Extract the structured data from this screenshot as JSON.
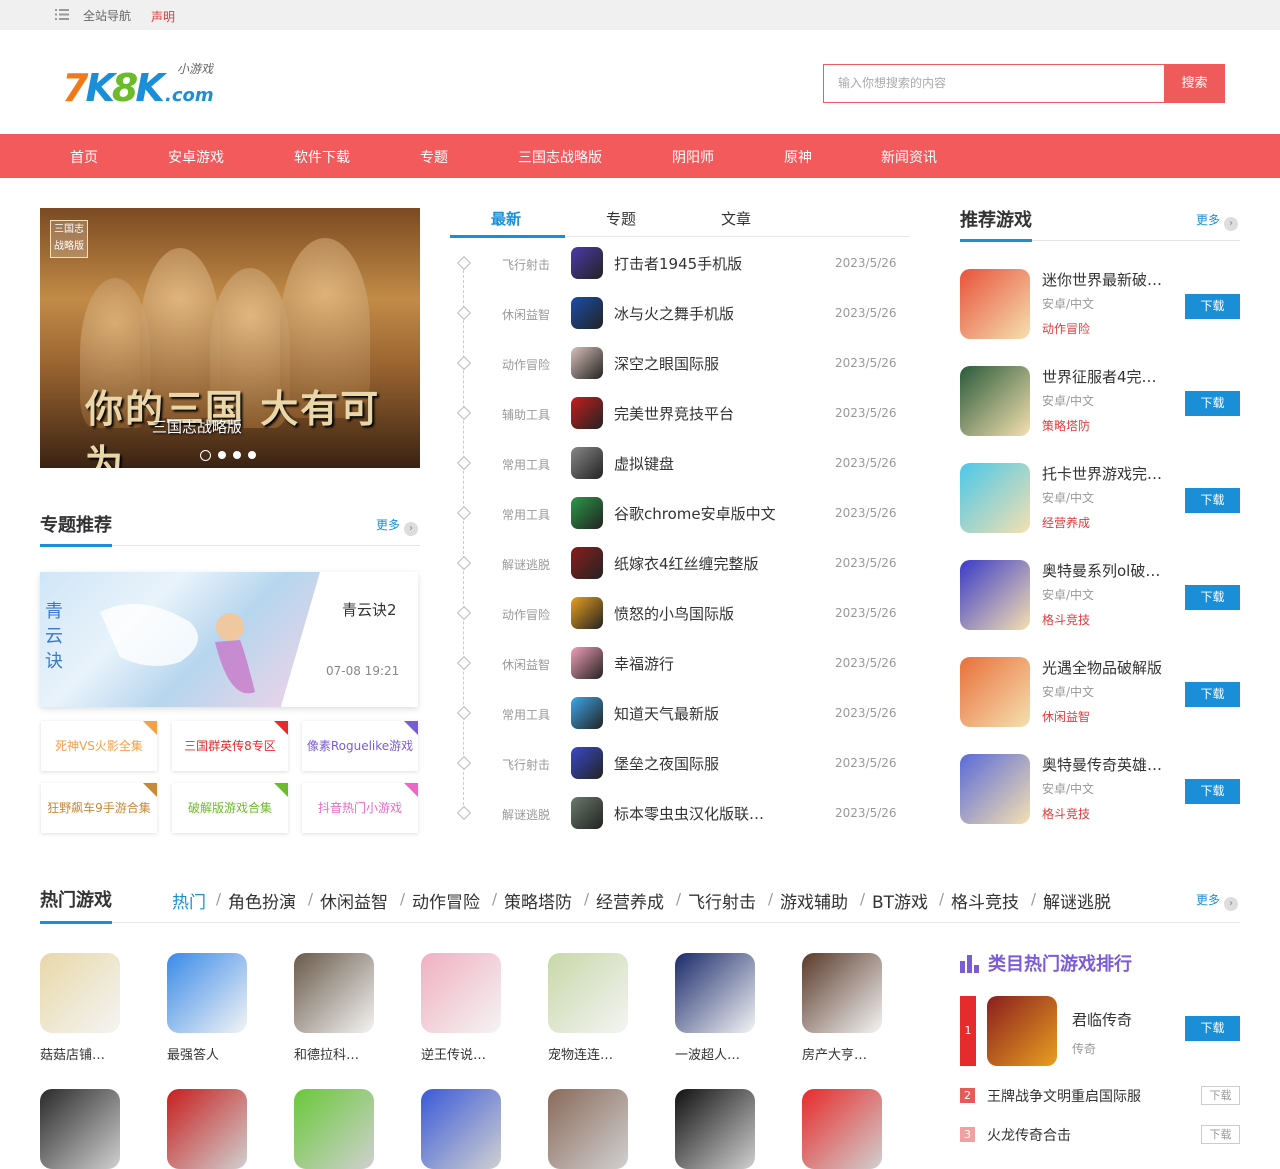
{
  "topbar": {
    "nav_label": "全站导航",
    "notice_label": "声明"
  },
  "header": {
    "logo_text": "7K8K",
    "logo_domain": ".com",
    "logo_tagline": "小游戏",
    "search_placeholder": "输入你想搜索的内容",
    "search_button": "搜索"
  },
  "nav": {
    "items": [
      "首页",
      "安卓游戏",
      "软件下载",
      "专题",
      "三国志战略版",
      "阴阳师",
      "原神",
      "新闻资讯"
    ]
  },
  "banner": {
    "stamp_text": "三国志战略版",
    "art_text": "你的三国 大有可为",
    "caption": "三国志战略版",
    "slide_count": 4,
    "active_slide": 1
  },
  "special": {
    "title": "专题推荐",
    "more": "更多",
    "card": {
      "title": "青云诀2",
      "date": "07-08 19:21"
    },
    "tags": [
      {
        "label": "死神VS火影全集",
        "color": "#f3a047"
      },
      {
        "label": "三国群英传8专区",
        "color": "#e52b2b"
      },
      {
        "label": "像素Roguelike游戏",
        "color": "#7b5cd6"
      },
      {
        "label": "狂野飙车9手游合集",
        "color": "#c8883a"
      },
      {
        "label": "破解版游戏合集",
        "color": "#6cbb2a"
      },
      {
        "label": "抖音热门小游戏",
        "color": "#e86ac6"
      }
    ]
  },
  "news": {
    "tabs": [
      "最新",
      "专题",
      "文章"
    ],
    "items": [
      {
        "cat": "飞行射击",
        "name": "打击者1945手机版",
        "date": "2023/5/26",
        "color": "#4b3aa8"
      },
      {
        "cat": "休闲益智",
        "name": "冰与火之舞手机版",
        "date": "2023/5/26",
        "color": "#1a4ea8"
      },
      {
        "cat": "动作冒险",
        "name": "深空之眼国际服",
        "date": "2023/5/26",
        "color": "#d8c0b8"
      },
      {
        "cat": "辅助工具",
        "name": "完美世界竞技平台",
        "date": "2023/5/26",
        "color": "#c41e1e"
      },
      {
        "cat": "常用工具",
        "name": "虚拟键盘",
        "date": "2023/5/26",
        "color": "#888888"
      },
      {
        "cat": "常用工具",
        "name": "谷歌chrome安卓版中文",
        "date": "2023/5/26",
        "color": "#2a9a4a"
      },
      {
        "cat": "解谜逃脱",
        "name": "纸嫁衣4红丝缠完整版",
        "date": "2023/5/26",
        "color": "#8a1e1e"
      },
      {
        "cat": "动作冒险",
        "name": "愤怒的小鸟国际版",
        "date": "2023/5/26",
        "color": "#e8a020"
      },
      {
        "cat": "休闲益智",
        "name": "幸福游行",
        "date": "2023/5/26",
        "color": "#f0a0b8"
      },
      {
        "cat": "常用工具",
        "name": "知道天气最新版",
        "date": "2023/5/26",
        "color": "#3aa8e8"
      },
      {
        "cat": "飞行射击",
        "name": "堡垒之夜国际服",
        "date": "2023/5/26",
        "color": "#3a4ac8"
      },
      {
        "cat": "解谜逃脱",
        "name": "标本零虫虫汉化版联…",
        "date": "2023/5/26",
        "color": "#6a7a6a"
      }
    ]
  },
  "recommend": {
    "title": "推荐游戏",
    "more": "更多",
    "items": [
      {
        "name": "迷你世界最新破…",
        "lang": "安卓/中文",
        "cat": "动作冒险",
        "dl": "下载",
        "color": "#e8523a"
      },
      {
        "name": "世界征服者4完…",
        "lang": "安卓/中文",
        "cat": "策略塔防",
        "dl": "下载",
        "color": "#2a5a3a"
      },
      {
        "name": "托卡世界游戏完…",
        "lang": "安卓/中文",
        "cat": "经营养成",
        "dl": "下载",
        "color": "#4ac8e8"
      },
      {
        "name": "奥特曼系列ol破…",
        "lang": "安卓/中文",
        "cat": "格斗竞技",
        "dl": "下载",
        "color": "#3a3ac8"
      },
      {
        "name": "光遇全物品破解版",
        "lang": "安卓/中文",
        "cat": "休闲益智",
        "dl": "下载",
        "color": "#e8703a"
      },
      {
        "name": "奥特曼传奇英雄…",
        "lang": "安卓/中文",
        "cat": "格斗竞技",
        "dl": "下载",
        "color": "#5a6ad8"
      }
    ]
  },
  "hot": {
    "title": "热门游戏",
    "more": "更多",
    "tabs": [
      "热门",
      "角色扮演",
      "休闲益智",
      "动作冒险",
      "策略塔防",
      "经营养成",
      "飞行射击",
      "游戏辅助",
      "BT游戏",
      "格斗竞技",
      "解谜逃脱"
    ],
    "row1": [
      {
        "name": "菇菇店铺…",
        "color": "#e8d8a8"
      },
      {
        "name": "最强答人",
        "color": "#3a8ae8"
      },
      {
        "name": "和德拉科…",
        "color": "#6a5a4a"
      },
      {
        "name": "逆王传说…",
        "color": "#f0b0c0"
      },
      {
        "name": "宠物连连…",
        "color": "#c8d8a8"
      },
      {
        "name": "一波超人…",
        "color": "#1a2a6a"
      },
      {
        "name": "房产大亨…",
        "color": "#5a3a2a"
      }
    ],
    "row2": [
      {
        "color": "#2a2a2a"
      },
      {
        "color": "#c81e1e"
      },
      {
        "color": "#6ac83a"
      },
      {
        "color": "#3a5ad8"
      },
      {
        "color": "#8a6a5a"
      },
      {
        "color": "#111111"
      },
      {
        "color": "#e82a2a"
      }
    ]
  },
  "ranking": {
    "title": "类目热门游戏排行",
    "top": {
      "rank": "1",
      "name": "君临传奇",
      "sub": "传奇",
      "dl": "下载",
      "color": "#8a1e1e"
    },
    "items": [
      {
        "rank": "2",
        "name": "王牌战争文明重启国际服",
        "dl": "下载",
        "color": "#e85a5a"
      },
      {
        "rank": "3",
        "name": "火龙传奇合击",
        "dl": "下载",
        "color": "#f0a0a0"
      }
    ]
  }
}
